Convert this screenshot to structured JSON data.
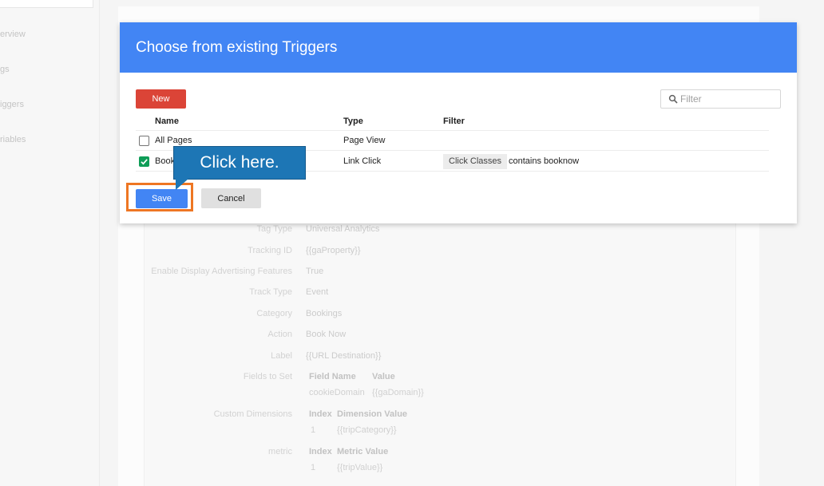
{
  "sidebar": {
    "items": [
      {
        "label": "erview"
      },
      {
        "label": "gs"
      },
      {
        "label": "iggers"
      },
      {
        "label": "riables"
      }
    ]
  },
  "background": {
    "fields": [
      {
        "label": "Tag Type",
        "value": "Universal Analytics"
      },
      {
        "label": "Tracking ID",
        "value": "{{gaProperty}}"
      },
      {
        "label": "Enable Display Advertising Features",
        "value": "True"
      },
      {
        "label": "Track Type",
        "value": "Event"
      },
      {
        "label": "Category",
        "value": "Bookings"
      },
      {
        "label": "Action",
        "value": "Book Now"
      },
      {
        "label": "Label",
        "value": "{{URL Destination}}"
      },
      {
        "label": "Fields to Set",
        "value": ""
      },
      {
        "label": "Custom Dimensions",
        "value": ""
      },
      {
        "label": "metric",
        "value": ""
      }
    ],
    "fields_to_set": {
      "h1": "Field Name",
      "h2": "Value",
      "v1": "cookieDomain",
      "v2": "{{gaDomain}}"
    },
    "custom_dimensions": {
      "h1": "Index",
      "h2": "Dimension Value",
      "v1": "1",
      "v2": "{{tripCategory}}"
    },
    "metric": {
      "h1": "Index",
      "h2": "Metric Value",
      "v1": "1",
      "v2": "{{tripValue}}"
    }
  },
  "dialog": {
    "title": "Choose from existing Triggers",
    "new_label": "New",
    "filter_placeholder": "Filter",
    "columns": {
      "name": "Name",
      "type": "Type",
      "filter": "Filter"
    },
    "rows": [
      {
        "name": "All Pages",
        "type": "Page View",
        "checked": false,
        "filter_var": "",
        "filter_text": ""
      },
      {
        "name": "Book",
        "type": "Link Click",
        "checked": true,
        "filter_var": "Click Classes",
        "filter_text": "contains booknow"
      }
    ],
    "save_label": "Save",
    "cancel_label": "Cancel"
  },
  "tutorial": {
    "callout_text": "Click here.",
    "highlight_color": "#ee7623",
    "callout_color": "#1d76b5"
  },
  "colors": {
    "header": "#4285f4",
    "new_button": "#db4437",
    "save_button": "#4285f4",
    "checkbox_checked": "#0f9d58"
  }
}
